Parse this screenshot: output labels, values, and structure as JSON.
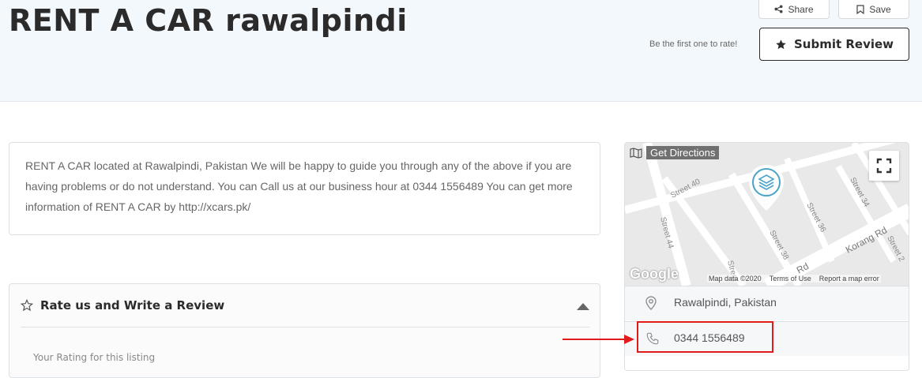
{
  "header": {
    "title": "RENT A CAR rawalpindi",
    "share_label": "Share",
    "save_label": "Save",
    "rate_hint": "Be the first one to rate!",
    "submit_label": "Submit Review"
  },
  "description": {
    "text": "RENT A CAR located at Rawalpindi, Pakistan We will be happy to guide you through any of the above if you are having problems or do not understand. You can Call us at our business hour at 0344 1556489 You can get more information of RENT A CAR by http://xcars.pk/"
  },
  "review": {
    "title": "Rate us and Write a Review",
    "sub_label": "Your Rating for this listing"
  },
  "map": {
    "get_directions": "Get Directions",
    "streets": [
      "Street 40",
      "Street 44",
      "Street 38",
      "Street 36",
      "Street 34",
      "Korang Rd",
      "Street 2",
      "Street",
      "Rd"
    ],
    "google_logo": "Google",
    "map_data": "Map data ©2020",
    "terms": "Terms of Use",
    "report": "Report a map error"
  },
  "info": {
    "address": "Rawalpindi, Pakistan",
    "phone": "0344 1556489"
  },
  "colors": {
    "highlight": "#e01b1b",
    "header_bg": "#f3f8fc",
    "marker": "#4aa3c9"
  }
}
